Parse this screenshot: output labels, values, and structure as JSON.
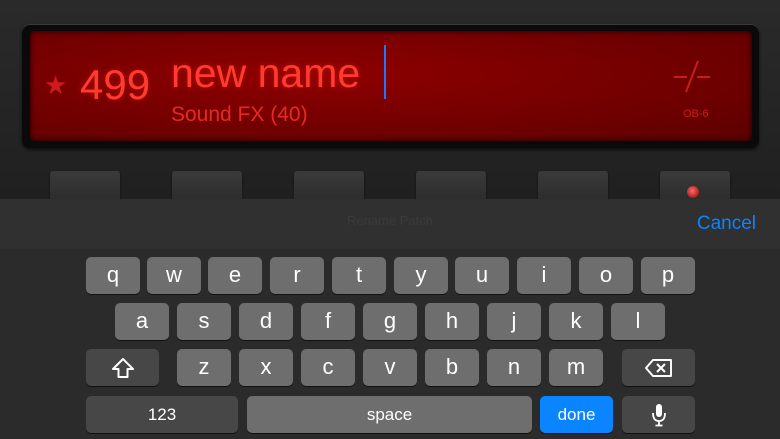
{
  "display": {
    "patch_number": "499",
    "patch_name": "new name",
    "category": "Sound FX (40)",
    "model": "OB-6",
    "favorite_icon": "star-icon",
    "accent_color": "#ff3b30"
  },
  "keyboard": {
    "header_hint": "Rename Patch",
    "cancel_label": "Cancel",
    "row1": [
      "q",
      "w",
      "e",
      "r",
      "t",
      "y",
      "u",
      "i",
      "o",
      "p"
    ],
    "row2": [
      "a",
      "s",
      "d",
      "f",
      "g",
      "h",
      "j",
      "k",
      "l"
    ],
    "row3": [
      "z",
      "x",
      "c",
      "v",
      "b",
      "n",
      "m"
    ],
    "shift_icon": "shift-icon",
    "backspace_icon": "backspace-icon",
    "numbers_label": "123",
    "space_label": "space",
    "done_label": "done",
    "mic_icon": "microphone-icon",
    "done_color": "#0a84ff"
  }
}
